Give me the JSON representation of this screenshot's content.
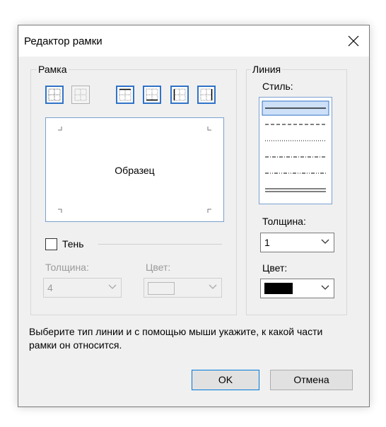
{
  "dialog": {
    "title": "Редактор рамки",
    "close_icon": "close-icon"
  },
  "frame_group": {
    "legend": "Рамка",
    "border_buttons": [
      "all-borders-icon",
      "no-borders-icon",
      "top-border-icon",
      "bottom-border-icon",
      "left-border-icon",
      "right-border-icon"
    ],
    "sample_text": "Образец",
    "shadow": {
      "label": "Тень",
      "checked": false,
      "thickness_label": "Толщина:",
      "thickness_value": "4",
      "color_label": "Цвет:"
    }
  },
  "line_group": {
    "legend": "Линия",
    "style_label": "Стиль:",
    "styles": [
      "solid",
      "dashed",
      "dotted",
      "dash-dot",
      "dash-dot-dot",
      "double"
    ],
    "selected_style": "solid",
    "thickness_label": "Толщина:",
    "thickness_value": "1",
    "color_label": "Цвет:",
    "color_value": "#000000"
  },
  "hint": "Выберите тип линии и с помощью мыши укажите, к какой части рамки он относится.",
  "buttons": {
    "ok": "OK",
    "cancel": "Отмена"
  },
  "colors": {
    "accent": "#2f73c7",
    "selection": "#cde0f7"
  }
}
